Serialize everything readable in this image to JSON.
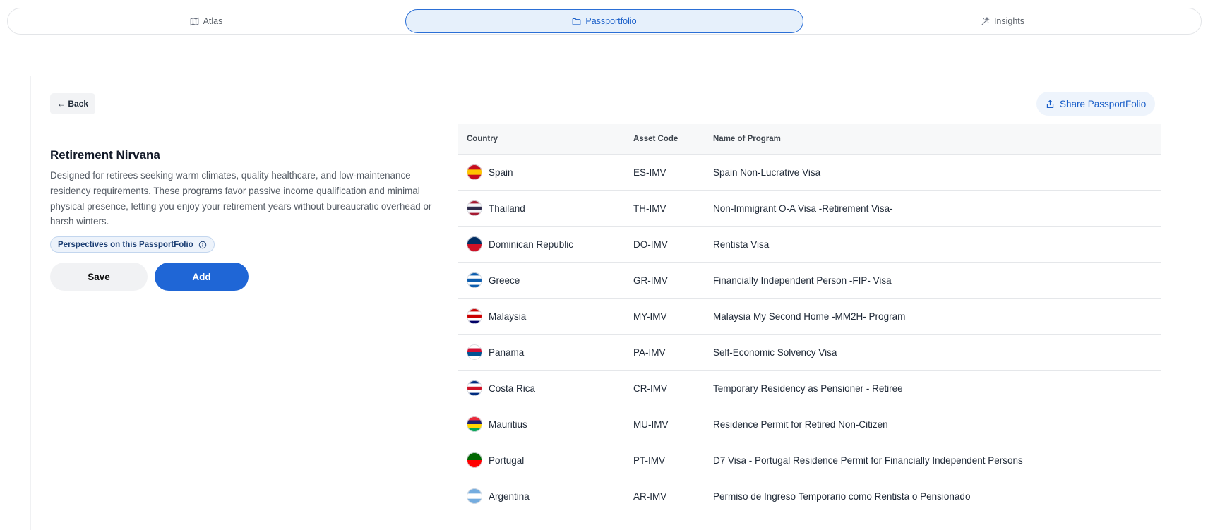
{
  "nav": {
    "tabs": [
      {
        "label": "Atlas",
        "icon": "map-icon"
      },
      {
        "label": "Passportfolio",
        "icon": "folder-icon"
      },
      {
        "label": "Insights",
        "icon": "sparkles-icon"
      }
    ]
  },
  "header": {
    "back_label": "← Back",
    "share_label": "Share PassportFolio"
  },
  "folio": {
    "title": "Retirement Nirvana",
    "description": "Designed for retirees seeking warm climates, quality healthcare, and low-maintenance residency requirements. These programs favor passive income qualification and minimal physical presence, letting you enjoy your retirement years without bureaucratic overhead or harsh winters.",
    "perspectives_label": "Perspectives on this PassportFolio",
    "save_label": "Save",
    "add_label": "Add"
  },
  "table": {
    "columns": [
      "Country",
      "Asset Code",
      "Name of Program"
    ],
    "rows": [
      {
        "country": "Spain",
        "code": "ES-IMV",
        "program": "Spain Non-Lucrative Visa",
        "flag": [
          "#c60b1e",
          "#ffc400",
          "#c60b1e"
        ]
      },
      {
        "country": "Thailand",
        "code": "TH-IMV",
        "program": "Non-Immigrant O-A Visa -Retirement Visa-",
        "flag": [
          "#a51931",
          "#f4f5f8",
          "#2d2a4a",
          "#f4f5f8",
          "#a51931"
        ]
      },
      {
        "country": "Dominican Republic",
        "code": "DO-IMV",
        "program": "Rentista Visa",
        "flag": [
          "#002d62",
          "#ce1126"
        ]
      },
      {
        "country": "Greece",
        "code": "GR-IMV",
        "program": "Financially Independent Person -FIP- Visa",
        "flag": [
          "#0d5eaf",
          "#ffffff",
          "#0d5eaf",
          "#ffffff",
          "#0d5eaf"
        ]
      },
      {
        "country": "Malaysia",
        "code": "MY-IMV",
        "program": "Malaysia My Second Home -MM2H- Program",
        "flag": [
          "#cc0001",
          "#ffffff",
          "#cc0001",
          "#ffffff",
          "#010066"
        ]
      },
      {
        "country": "Panama",
        "code": "PA-IMV",
        "program": "Self-Economic Solvency Visa",
        "flag": [
          "#ffffff",
          "#d21034",
          "#005293",
          "#ffffff"
        ]
      },
      {
        "country": "Costa Rica",
        "code": "CR-IMV",
        "program": "Temporary Residency as Pensioner - Retiree",
        "flag": [
          "#002b7f",
          "#ffffff",
          "#ce1126",
          "#ffffff",
          "#002b7f"
        ]
      },
      {
        "country": "Mauritius",
        "code": "MU-IMV",
        "program": "Residence Permit for Retired Non-Citizen",
        "flag": [
          "#ea2839",
          "#1a206d",
          "#ffd500",
          "#00a551"
        ]
      },
      {
        "country": "Portugal",
        "code": "PT-IMV",
        "program": "D7 Visa - Portugal Residence Permit for Financially Independent Persons",
        "flag": [
          "#006600",
          "#ff0000"
        ]
      },
      {
        "country": "Argentina",
        "code": "AR-IMV",
        "program": "Permiso de Ingreso Temporario como Rentista o Pensionado",
        "flag": [
          "#74acdf",
          "#ffffff",
          "#74acdf"
        ]
      }
    ]
  }
}
